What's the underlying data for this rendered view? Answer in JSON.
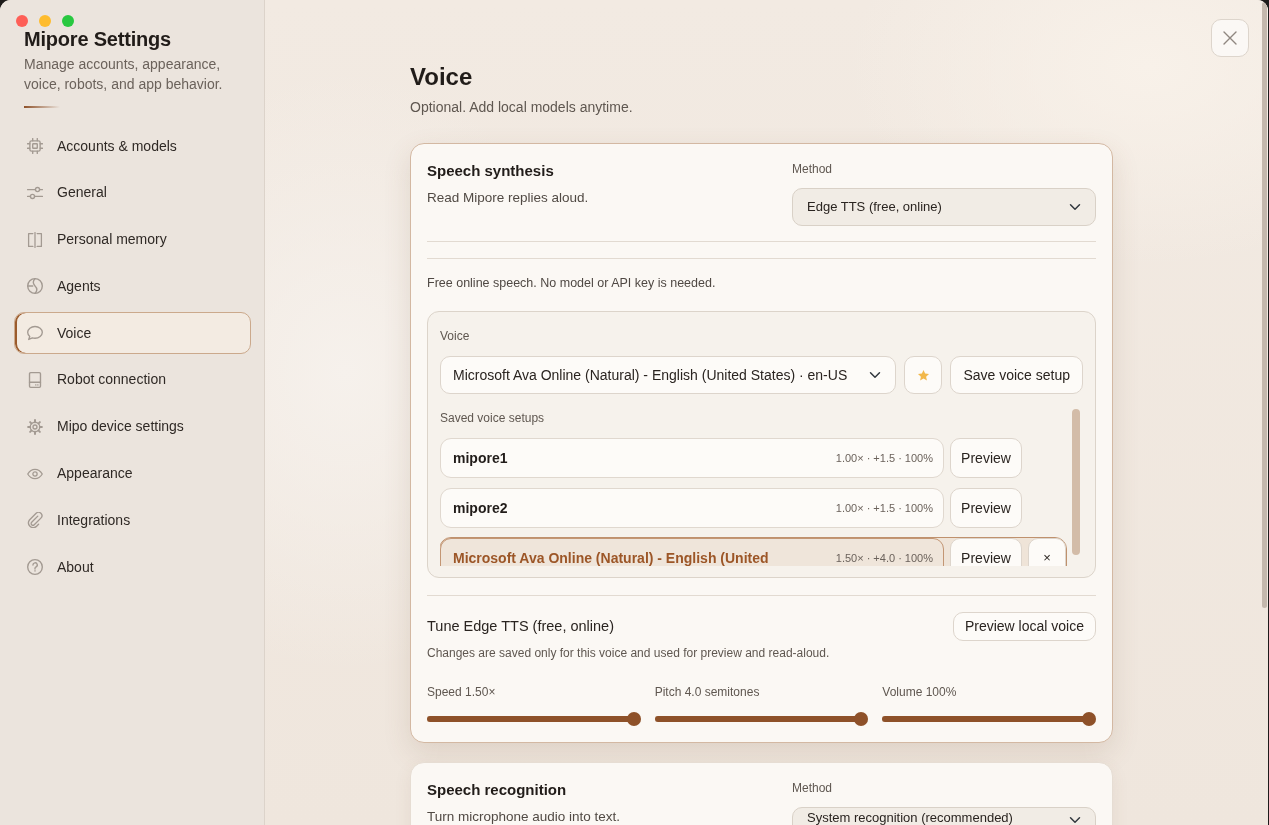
{
  "window": {
    "title": "Mipore Settings",
    "subtitle": "Manage accounts, appearance, voice, robots, and app behavior."
  },
  "sidebar": {
    "items": [
      {
        "label": "Accounts & models",
        "selected": false
      },
      {
        "label": "General",
        "selected": false
      },
      {
        "label": "Personal memory",
        "selected": false
      },
      {
        "label": "Agents",
        "selected": false
      },
      {
        "label": "Voice",
        "selected": true
      },
      {
        "label": "Robot connection",
        "selected": false
      },
      {
        "label": "Mipo device settings",
        "selected": false
      },
      {
        "label": "Appearance",
        "selected": false
      },
      {
        "label": "Integrations",
        "selected": false
      },
      {
        "label": "About",
        "selected": false
      }
    ]
  },
  "page": {
    "title": "Voice",
    "subtitle": "Optional. Add local models anytime."
  },
  "speech_synthesis": {
    "title": "Speech synthesis",
    "description": "Read Mipore replies aloud.",
    "method_label": "Method",
    "method": "Edge TTS (free, online)",
    "note": "Free online speech. No model or API key is needed.",
    "voice": {
      "label": "Voice",
      "selection": "Microsoft Ava Online (Natural) - English (United States) · en-US",
      "save_button": "Save voice setup"
    },
    "saved_setups": {
      "label": "Saved voice setups",
      "items": [
        {
          "name": "mipore1",
          "stats": "1.00× · +1.5 · 100%",
          "preview_button": "Preview",
          "selected": false
        },
        {
          "name": "mipore2",
          "stats": "1.00× · +1.5 · 100%",
          "preview_button": "Preview",
          "selected": false
        },
        {
          "name": "Microsoft Ava Online (Natural) - English (United",
          "stats": "1.50× · +4.0 · 100%",
          "preview_button": "Preview",
          "delete_button": "×",
          "selected": true
        }
      ]
    },
    "tune": {
      "title": "Tune Edge TTS (free, online)",
      "preview_button": "Preview local voice",
      "note": "Changes are saved only for this voice and used for preview and read-aloud.",
      "sliders": [
        {
          "label": "Speed 1.50×",
          "level": 1
        },
        {
          "label": "Pitch 4.0 semitones",
          "level": 1
        },
        {
          "label": "Volume 100%",
          "level": 1
        }
      ]
    }
  },
  "speech_recognition": {
    "title": "Speech recognition",
    "description": "Turn microphone audio into text.",
    "method_label": "Method",
    "method": "System recognition (recommended)"
  }
}
